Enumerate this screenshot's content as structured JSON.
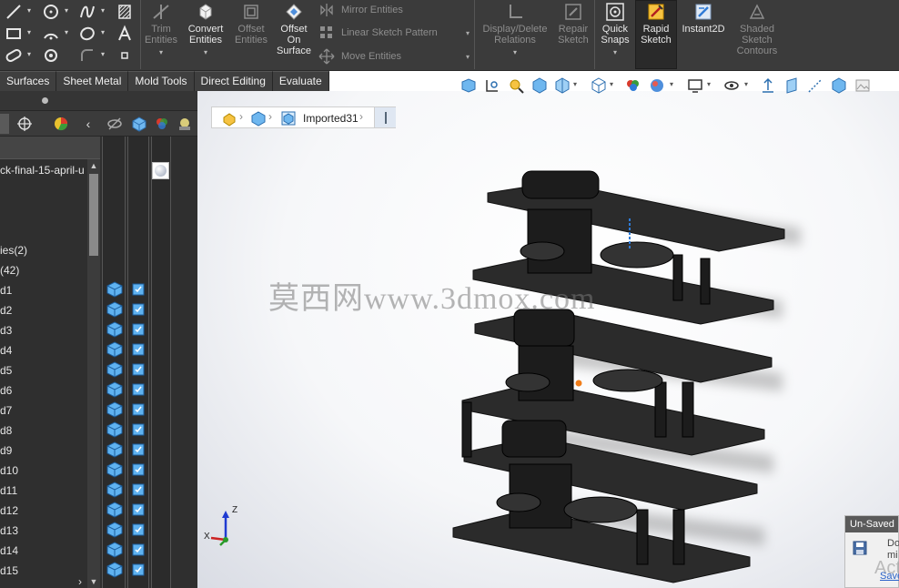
{
  "ribbon": {
    "sketch_tools": [
      {
        "icon": "line-icon"
      },
      {
        "icon": "circle-icon"
      },
      {
        "icon": "spline-icon"
      },
      {
        "icon": "hatch-icon"
      },
      {
        "icon": "rectangle-icon"
      },
      {
        "icon": "arc-icon"
      },
      {
        "icon": "polygon-icon"
      },
      {
        "icon": "text-icon"
      },
      {
        "icon": "slot-icon"
      },
      {
        "icon": "point-icon"
      },
      {
        "icon": "fillet-icon"
      },
      {
        "icon": "small-point-icon"
      }
    ],
    "buttons": {
      "trim_entities": "Trim\nEntities",
      "convert_entities": "Convert\nEntities",
      "offset_entities": "Offset\nEntities",
      "offset_on_surface": "Offset\nOn\nSurface",
      "display_delete_relations": "Display/Delete\nRelations",
      "repair_sketch": "Repair\nSketch",
      "quick_snaps": "Quick\nSnaps",
      "rapid_sketch": "Rapid\nSketch",
      "instant2d": "Instant2D",
      "shaded_sketch_contours": "Shaded\nSketch\nContours"
    },
    "mirror_entities": "Mirror Entities",
    "linear_sketch_pattern": "Linear Sketch Pattern",
    "move_entities": "Move Entities"
  },
  "tabs": [
    "Surfaces",
    "Sheet Metal",
    "Mold Tools",
    "Direct Editing",
    "Evaluate"
  ],
  "tree": {
    "items": [
      "ck-final-15-april-u",
      "",
      "",
      "ies(2)",
      "(42)",
      "d1",
      "d2",
      "d3",
      "d4",
      "d5",
      "d6",
      "d7",
      "d8",
      "d9",
      "d10",
      "d11",
      "d12",
      "d13",
      "d14",
      "d15"
    ]
  },
  "breadcrumb": {
    "label": "Imported31"
  },
  "watermark": "莫西网www.3dmox.com",
  "triad": {
    "z": "Z",
    "x": "X"
  },
  "unsaved": {
    "title": "Un-Saved",
    "body_line1": "Do",
    "body_line2": "mi",
    "faded": "Act",
    "link": "Save"
  },
  "colors": {
    "ribbon_bg": "#3b3b3b",
    "panel_bg": "#2f2f2f",
    "accent_blue": "#2f7bd6",
    "tab_bg": "#3f3f3f"
  }
}
